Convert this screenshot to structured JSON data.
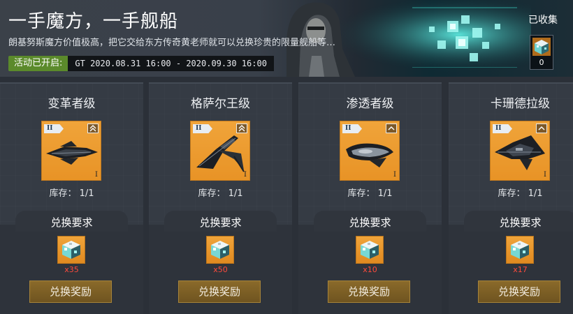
{
  "header": {
    "title": "一手魔方，一手舰船",
    "description": "朗基努斯魔方价值极高，把它交给东方传奇黄老师就可以兑换珍贵的限量舰船等…",
    "status_badge": "活动已开启:",
    "time_range": "GT 2020.08.31 16:00 - 2020.09.30 16:00",
    "collected_label": "已收集",
    "collected_count": "0",
    "banner_icon": "cyber-cube"
  },
  "cards": [
    {
      "name": "变革者级",
      "tier": "II",
      "level": "I",
      "stock_label": "库存：",
      "stock_value": "1/1",
      "req_title": "兑换要求",
      "req_icon": "longinus-cube-icon",
      "req_qty": "x35",
      "button": "兑换奖励",
      "rank_icon": "double-chevron-up"
    },
    {
      "name": "格萨尔王级",
      "tier": "II",
      "level": "I",
      "stock_label": "库存：",
      "stock_value": "1/1",
      "req_title": "兑换要求",
      "req_icon": "longinus-cube-icon",
      "req_qty": "x50",
      "button": "兑换奖励",
      "rank_icon": "double-chevron-up"
    },
    {
      "name": "渗透者级",
      "tier": "II",
      "level": "I",
      "stock_label": "库存：",
      "stock_value": "1/1",
      "req_title": "兑换要求",
      "req_icon": "longinus-cube-icon",
      "req_qty": "x10",
      "button": "兑换奖励",
      "rank_icon": "chevron-up"
    },
    {
      "name": "卡珊德拉级",
      "tier": "II",
      "level": "I",
      "stock_label": "库存：",
      "stock_value": "1/1",
      "req_title": "兑换要求",
      "req_icon": "longinus-cube-icon",
      "req_qty": "x17",
      "button": "兑换奖励",
      "rank_icon": "chevron-up"
    }
  ],
  "colors": {
    "accent_orange": "#e89326",
    "qty_red": "#ff4a3c",
    "badge_green": "#5b8a2b",
    "button_gold": "#7a5e24"
  }
}
